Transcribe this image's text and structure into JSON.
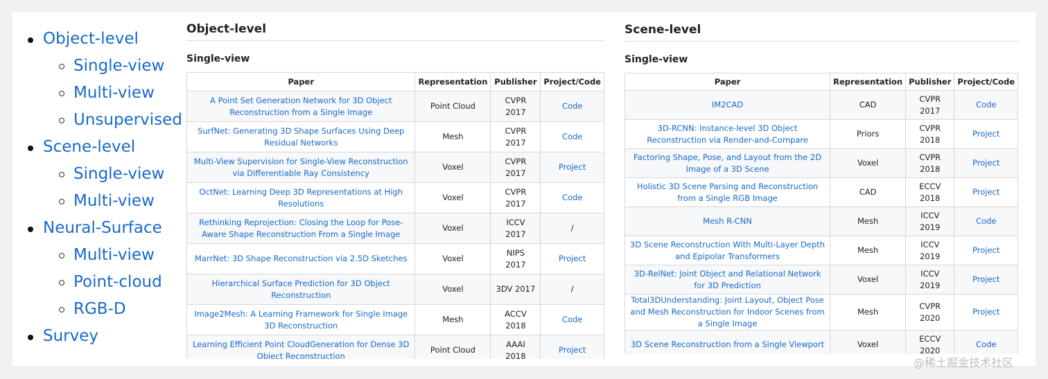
{
  "toc": [
    {
      "label": "Object-level",
      "children": [
        {
          "label": "Single-view"
        },
        {
          "label": "Multi-view"
        },
        {
          "label": "Unsupervised"
        }
      ]
    },
    {
      "label": "Scene-level",
      "children": [
        {
          "label": "Single-view"
        },
        {
          "label": "Multi-view"
        }
      ]
    },
    {
      "label": "Neural-Surface",
      "children": [
        {
          "label": "Multi-view"
        },
        {
          "label": "Point-cloud"
        },
        {
          "label": "RGB-D"
        }
      ]
    },
    {
      "label": "Survey",
      "children": []
    }
  ],
  "object_level": {
    "title": "Object-level",
    "subtitle": "Single-view",
    "headers": [
      "Paper",
      "Representation",
      "Publisher",
      "Project/Code"
    ],
    "rows": [
      {
        "paper": "A Point Set Generation Network for 3D Object Reconstruction from a Single Image",
        "rep": "Point Cloud",
        "pub": "CVPR 2017",
        "code": "Code"
      },
      {
        "paper": "SurfNet: Generating 3D Shape Surfaces Using Deep Residual Networks",
        "rep": "Mesh",
        "pub": "CVPR 2017",
        "code": "Code"
      },
      {
        "paper": "Multi-View Supervision for Single-View Reconstruction via Differentiable Ray Consistency",
        "rep": "Voxel",
        "pub": "CVPR 2017",
        "code": "Project"
      },
      {
        "paper": "OctNet: Learning Deep 3D Representations at High Resolutions",
        "rep": "Voxel",
        "pub": "CVPR 2017",
        "code": "Code"
      },
      {
        "paper": "Rethinking Reprojection: Closing the Loop for Pose-Aware Shape Reconstruction From a Single Image",
        "rep": "Voxel",
        "pub": "ICCV 2017",
        "code": "/"
      },
      {
        "paper": "MarrNet: 3D Shape Reconstruction via 2.5D Sketches",
        "rep": "Voxel",
        "pub": "NIPS 2017",
        "code": "Project"
      },
      {
        "paper": "Hierarchical Surface Prediction for 3D Object Reconstruction",
        "rep": "Voxel",
        "pub": "3DV 2017",
        "code": "/"
      },
      {
        "paper": "Image2Mesh: A Learning Framework for Single Image 3D Reconstruction",
        "rep": "Mesh",
        "pub": "ACCV 2018",
        "code": "Code"
      },
      {
        "paper": "Learning Efficient Point CloudGeneration for Dense 3D Object Reconstruction",
        "rep": "Point Cloud",
        "pub": "AAAI 2018",
        "code": "Project"
      }
    ]
  },
  "scene_level": {
    "title": "Scene-level",
    "subtitle": "Single-view",
    "headers": [
      "Paper",
      "Representation",
      "Publisher",
      "Project/Code"
    ],
    "rows": [
      {
        "paper": "IM2CAD",
        "rep": "CAD",
        "pub": "CVPR 2017",
        "code": "Code"
      },
      {
        "paper": "3D-RCNN: Instance-level 3D Object Reconstruction via Render-and-Compare",
        "rep": "Priors",
        "pub": "CVPR 2018",
        "code": "Project"
      },
      {
        "paper": "Factoring Shape, Pose, and Layout from the 2D Image of a 3D Scene",
        "rep": "Voxel",
        "pub": "CVPR 2018",
        "code": "Project"
      },
      {
        "paper": "Holistic 3D Scene Parsing and Reconstruction from a Single RGB Image",
        "rep": "CAD",
        "pub": "ECCV 2018",
        "code": "Project"
      },
      {
        "paper": "Mesh R-CNN",
        "rep": "Mesh",
        "pub": "ICCV 2019",
        "code": "Code"
      },
      {
        "paper": "3D Scene Reconstruction With Multi-Layer Depth and Epipolar Transformers",
        "rep": "Mesh",
        "pub": "ICCV 2019",
        "code": "Project"
      },
      {
        "paper": "3D-RelNet: Joint Object and Relational Network for 3D Prediction",
        "rep": "Voxel",
        "pub": "ICCV 2019",
        "code": "Project"
      },
      {
        "paper": "Total3DUnderstanding: Joint Layout, Object Pose and Mesh Reconstruction for Indoor Scenes from a Single Image",
        "rep": "Mesh",
        "pub": "CVPR 2020",
        "code": "Project"
      },
      {
        "paper": "3D Scene Reconstruction from a Single Viewport",
        "rep": "Voxel",
        "pub": "ECCV 2020",
        "code": "Code"
      }
    ]
  },
  "watermark": "@稀土掘金技术社区",
  "colors": {
    "link": "#1769c9",
    "row_stripe": "#f6f8fa",
    "border": "#d7d7d7"
  }
}
